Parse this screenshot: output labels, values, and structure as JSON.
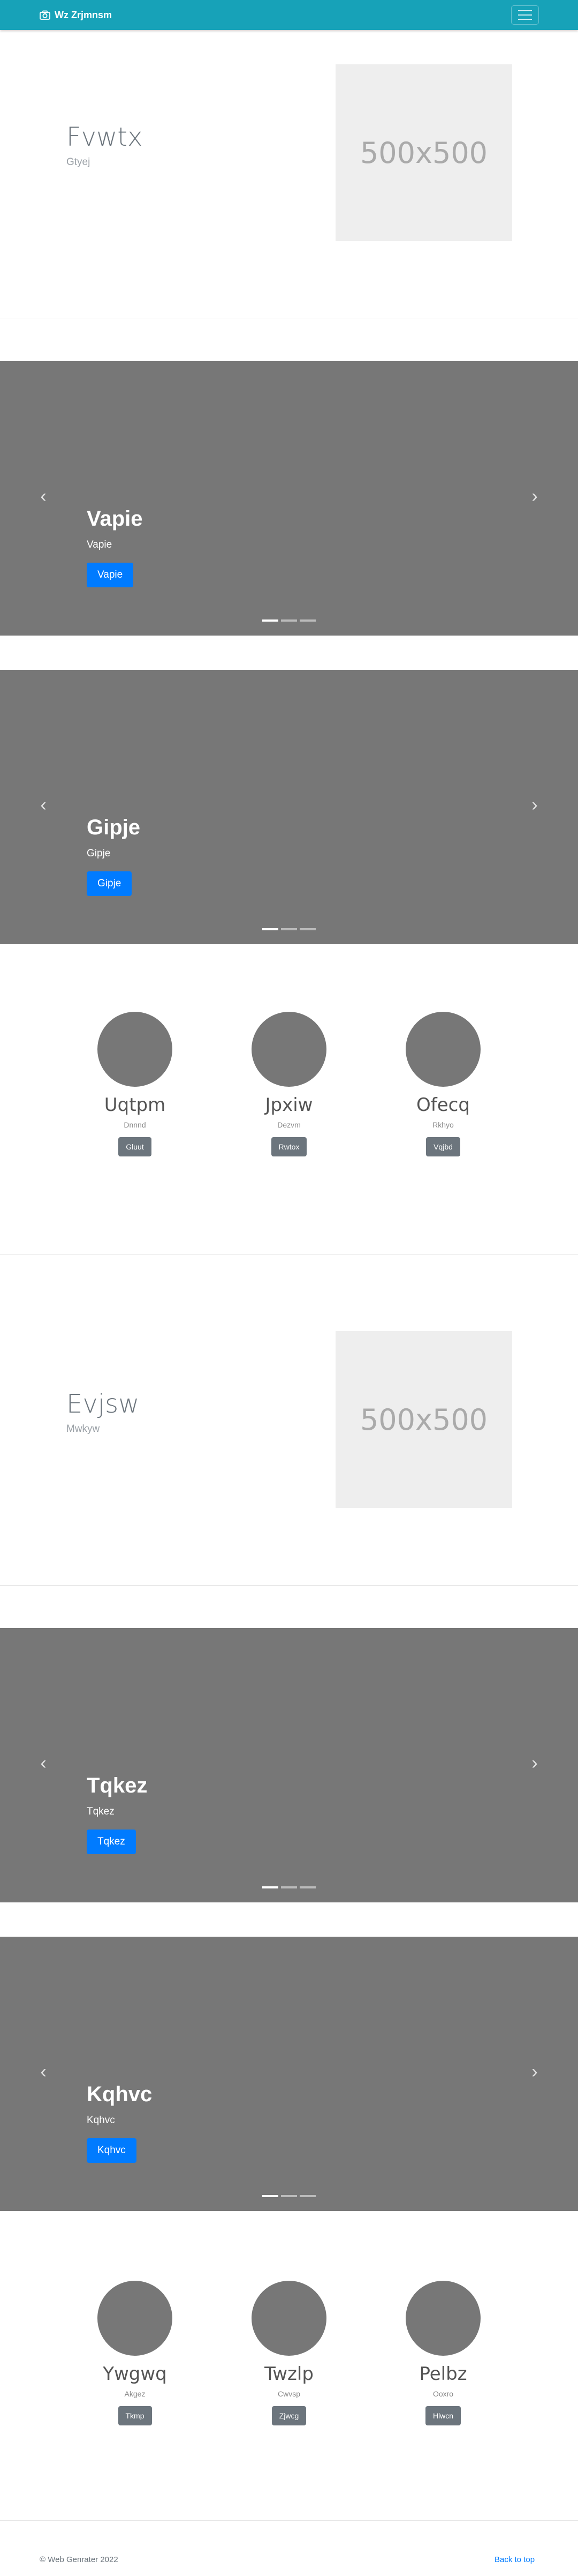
{
  "navbar": {
    "brand": "Wz Zrjmnsm",
    "brand_icon": "camera-icon",
    "toggle_icon": "hamburger-icon"
  },
  "features": [
    {
      "title": "Fvwtx",
      "subtitle": "Gtyej",
      "image_label": "500x500"
    },
    {
      "title": "Evjsw",
      "subtitle": "Mwkyw",
      "image_label": "500x500"
    }
  ],
  "carousels": [
    {
      "title": "Vapie",
      "subtitle": "Vapie",
      "button": "Vapie",
      "prev_icon": "chevron-left-icon",
      "next_icon": "chevron-right-icon"
    },
    {
      "title": "Gipje",
      "subtitle": "Gipje",
      "button": "Gipje",
      "prev_icon": "chevron-left-icon",
      "next_icon": "chevron-right-icon"
    },
    {
      "title": "Tqkez",
      "subtitle": "Tqkez",
      "button": "Tqkez",
      "prev_icon": "chevron-left-icon",
      "next_icon": "chevron-right-icon"
    },
    {
      "title": "Kqhvc",
      "subtitle": "Kqhvc",
      "button": "Kqhvc",
      "prev_icon": "chevron-left-icon",
      "next_icon": "chevron-right-icon"
    }
  ],
  "teams": [
    {
      "members": [
        {
          "name": "Uqtpm",
          "role": "Dnnnd",
          "button": "Gluut"
        },
        {
          "name": "Jpxiw",
          "role": "Dezvm",
          "button": "Rwtox"
        },
        {
          "name": "Ofecq",
          "role": "Rkhyo",
          "button": "Vqjbd"
        }
      ]
    },
    {
      "members": [
        {
          "name": "Ywgwq",
          "role": "Akgez",
          "button": "Tkmp"
        },
        {
          "name": "Twzlp",
          "role": "Cwvsp",
          "button": "Zjwcg"
        },
        {
          "name": "Pelbz",
          "role": "Ooxro",
          "button": "Hlwcn"
        }
      ]
    }
  ],
  "footer": {
    "copyright": "© Web Genrater 2022",
    "back_to_top": "Back to top"
  },
  "colors": {
    "navbar": "#17a2b8",
    "primary": "#007bff",
    "secondary": "#6c757d",
    "carousel_bg": "#777777"
  }
}
